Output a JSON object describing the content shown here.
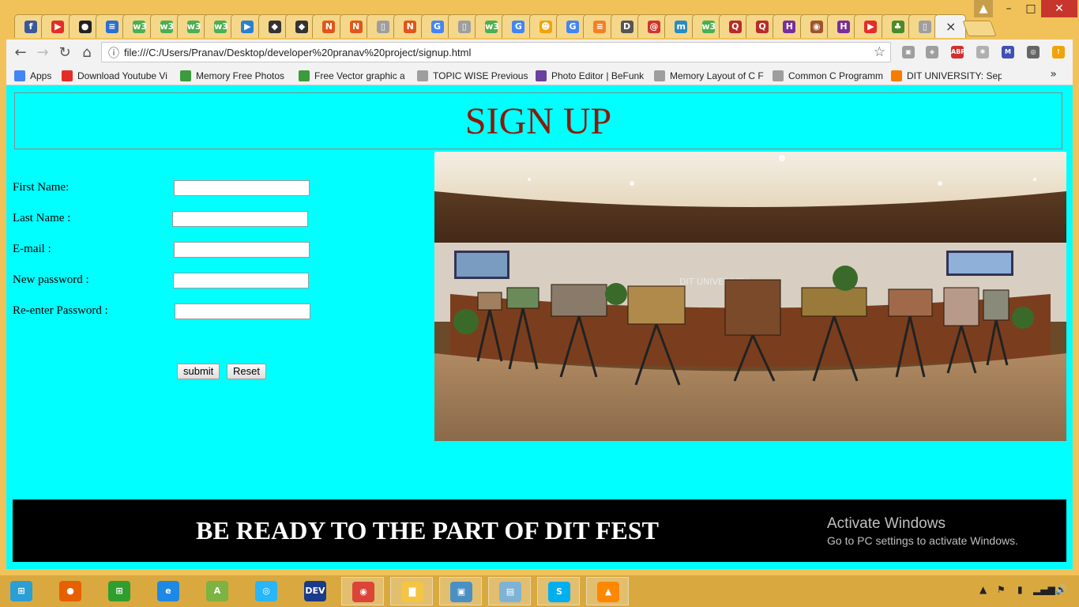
{
  "browser": {
    "tabs": [
      {
        "icon": "facebook-icon",
        "color": "#3b5998",
        "glyph": "f"
      },
      {
        "icon": "youtube-icon",
        "color": "#e52d27",
        "glyph": "▶"
      },
      {
        "icon": "github-icon",
        "color": "#222222",
        "glyph": "●"
      },
      {
        "icon": "stack-icon",
        "color": "#2a6fd1",
        "glyph": "≡"
      },
      {
        "icon": "w3schools-icon",
        "color": "#4caf50",
        "glyph": "w3"
      },
      {
        "icon": "w3schools-icon",
        "color": "#4caf50",
        "glyph": "w3"
      },
      {
        "icon": "w3schools-icon",
        "color": "#4caf50",
        "glyph": "w3"
      },
      {
        "icon": "w3schools-icon",
        "color": "#4caf50",
        "glyph": "w3"
      },
      {
        "icon": "play-icon",
        "color": "#2a7fd4",
        "glyph": "▶"
      },
      {
        "icon": "wolf-icon",
        "color": "#333333",
        "glyph": "◆"
      },
      {
        "icon": "wolf-icon",
        "color": "#333333",
        "glyph": "◆"
      },
      {
        "icon": "n-icon",
        "color": "#e0561b",
        "glyph": "N"
      },
      {
        "icon": "n-icon",
        "color": "#e0561b",
        "glyph": "N"
      },
      {
        "icon": "page-icon",
        "color": "#9e9e9e",
        "glyph": "▯"
      },
      {
        "icon": "n-icon",
        "color": "#e0561b",
        "glyph": "N"
      },
      {
        "icon": "google-icon",
        "color": "#4285f4",
        "glyph": "G"
      },
      {
        "icon": "page-icon",
        "color": "#9e9e9e",
        "glyph": "▯"
      },
      {
        "icon": "w3schools-icon",
        "color": "#4caf50",
        "glyph": "w3"
      },
      {
        "icon": "google-icon",
        "color": "#4285f4",
        "glyph": "G"
      },
      {
        "icon": "smiley-icon",
        "color": "#f0a30a",
        "glyph": "☻"
      },
      {
        "icon": "google-icon",
        "color": "#4285f4",
        "glyph": "G"
      },
      {
        "icon": "stackoverflow-icon",
        "color": "#f48024",
        "glyph": "≡"
      },
      {
        "icon": "dit-icon",
        "color": "#555555",
        "glyph": "D"
      },
      {
        "icon": "swirl-icon",
        "color": "#d0342c",
        "glyph": "@"
      },
      {
        "icon": "m-icon",
        "color": "#2a8cbf",
        "glyph": "m"
      },
      {
        "icon": "w3schools-icon",
        "color": "#4caf50",
        "glyph": "w3"
      },
      {
        "icon": "quora-icon",
        "color": "#b92b27",
        "glyph": "Q"
      },
      {
        "icon": "quora-icon",
        "color": "#b92b27",
        "glyph": "Q"
      },
      {
        "icon": "h-icon",
        "color": "#7b2d9b",
        "glyph": "H"
      },
      {
        "icon": "owl-icon",
        "color": "#a0522d",
        "glyph": "◉"
      },
      {
        "icon": "h-icon",
        "color": "#7b2d9b",
        "glyph": "H"
      },
      {
        "icon": "youtube-icon",
        "color": "#e52d27",
        "glyph": "▶"
      },
      {
        "icon": "leaf-icon",
        "color": "#4a8a2a",
        "glyph": "♣"
      },
      {
        "icon": "page-icon",
        "color": "#9e9e9e",
        "glyph": "▯"
      }
    ],
    "active_tab_close": "×",
    "window": {
      "user": "▲",
      "minimize": "–",
      "maximize": "□",
      "close": "✕"
    },
    "nav": {
      "back": "←",
      "forward": "→",
      "reload": "↻",
      "home": "⌂"
    },
    "omnibox": {
      "info": "ⓘ",
      "url": "file:///C:/Users/Pranav/Desktop/developer%20pranav%20project/signup.html",
      "star": "☆"
    },
    "extensions": [
      {
        "icon": "extension-icon",
        "color": "#9e9e9e",
        "glyph": "▣"
      },
      {
        "icon": "extension-icon",
        "color": "#9e9e9e",
        "glyph": "◈"
      },
      {
        "icon": "adblock-plus-icon",
        "color": "#d32f2f",
        "glyph": "ABP"
      },
      {
        "icon": "extension-icon",
        "color": "#b0b0b0",
        "glyph": "✱"
      },
      {
        "icon": "gmail-icon",
        "color": "#3f51b5",
        "glyph": "M"
      },
      {
        "icon": "extension-icon",
        "color": "#666666",
        "glyph": "◎"
      },
      {
        "icon": "alert-icon",
        "color": "#f0a30a",
        "glyph": "!"
      }
    ],
    "bookmarks": [
      {
        "label": "Apps",
        "color": "#4285f4"
      },
      {
        "label": "Download Youtube Vi",
        "color": "#e52d27"
      },
      {
        "label": "Memory Free Photos",
        "color": "#3c9b3c"
      },
      {
        "label": "Free Vector graphic a",
        "color": "#3c9b3c"
      },
      {
        "label": "TOPIC WISE Previous",
        "color": "#9e9e9e"
      },
      {
        "label": "Photo Editor | BeFunk",
        "color": "#6a3fa0"
      },
      {
        "label": "Memory Layout of C F",
        "color": "#9e9e9e"
      },
      {
        "label": "Common C Programm",
        "color": "#9e9e9e"
      },
      {
        "label": "DIT UNIVERSITY: Sept",
        "color": "#f57c00"
      }
    ],
    "bookmarks_more": "»"
  },
  "page": {
    "title": "SIGN UP",
    "form": {
      "first_name_label": "First Name:",
      "last_name_label": "Last Name :",
      "email_label": "E-mail :",
      "new_password_label": "New password :",
      "reenter_password_label": "Re-enter Password :",
      "first_name_value": "",
      "last_name_value": "",
      "email_value": "",
      "new_password_value": "",
      "reenter_password_value": "",
      "submit_label": "submit",
      "reset_label": "Reset"
    },
    "photo_caption": "DIT UNIVERSITY",
    "footer_text": "BE READY TO THE PART OF DIT FEST"
  },
  "watermark": {
    "title": "Activate Windows",
    "subtitle": "Go to PC settings to activate Windows."
  },
  "taskbar": {
    "apps": [
      {
        "icon": "windows-start-icon",
        "color": "#2a9fd6",
        "glyph": "⊞",
        "active": false
      },
      {
        "icon": "firefox-icon",
        "color": "#e66000",
        "glyph": "●",
        "active": false
      },
      {
        "icon": "store-icon",
        "color": "#2e9e2e",
        "glyph": "⊞",
        "active": false
      },
      {
        "icon": "internet-explorer-icon",
        "color": "#1e88e5",
        "glyph": "e",
        "active": false
      },
      {
        "icon": "android-studio-icon",
        "color": "#7cb342",
        "glyph": "A",
        "active": false
      },
      {
        "icon": "shareit-icon",
        "color": "#29b6f6",
        "glyph": "◎",
        "active": false
      },
      {
        "icon": "devcpp-icon",
        "color": "#1a3a8a",
        "glyph": "DEV",
        "active": false
      },
      {
        "icon": "chrome-icon",
        "color": "#db4437",
        "glyph": "◉",
        "active": true
      },
      {
        "icon": "file-explorer-icon",
        "color": "#f4c542",
        "glyph": "▇",
        "active": true
      },
      {
        "icon": "photo-viewer-icon",
        "color": "#4a90c2",
        "glyph": "▣",
        "active": true
      },
      {
        "icon": "notepad-icon",
        "color": "#7fb3d5",
        "glyph": "▤",
        "active": true
      },
      {
        "icon": "skype-icon",
        "color": "#00aff0",
        "glyph": "S",
        "active": true
      },
      {
        "icon": "vlc-icon",
        "color": "#ff8800",
        "glyph": "▲",
        "active": true
      }
    ],
    "tray": {
      "up": "▲",
      "flag": "⚑",
      "battery": "▮",
      "signal": "▂▄▆",
      "volume": "🔊"
    }
  }
}
